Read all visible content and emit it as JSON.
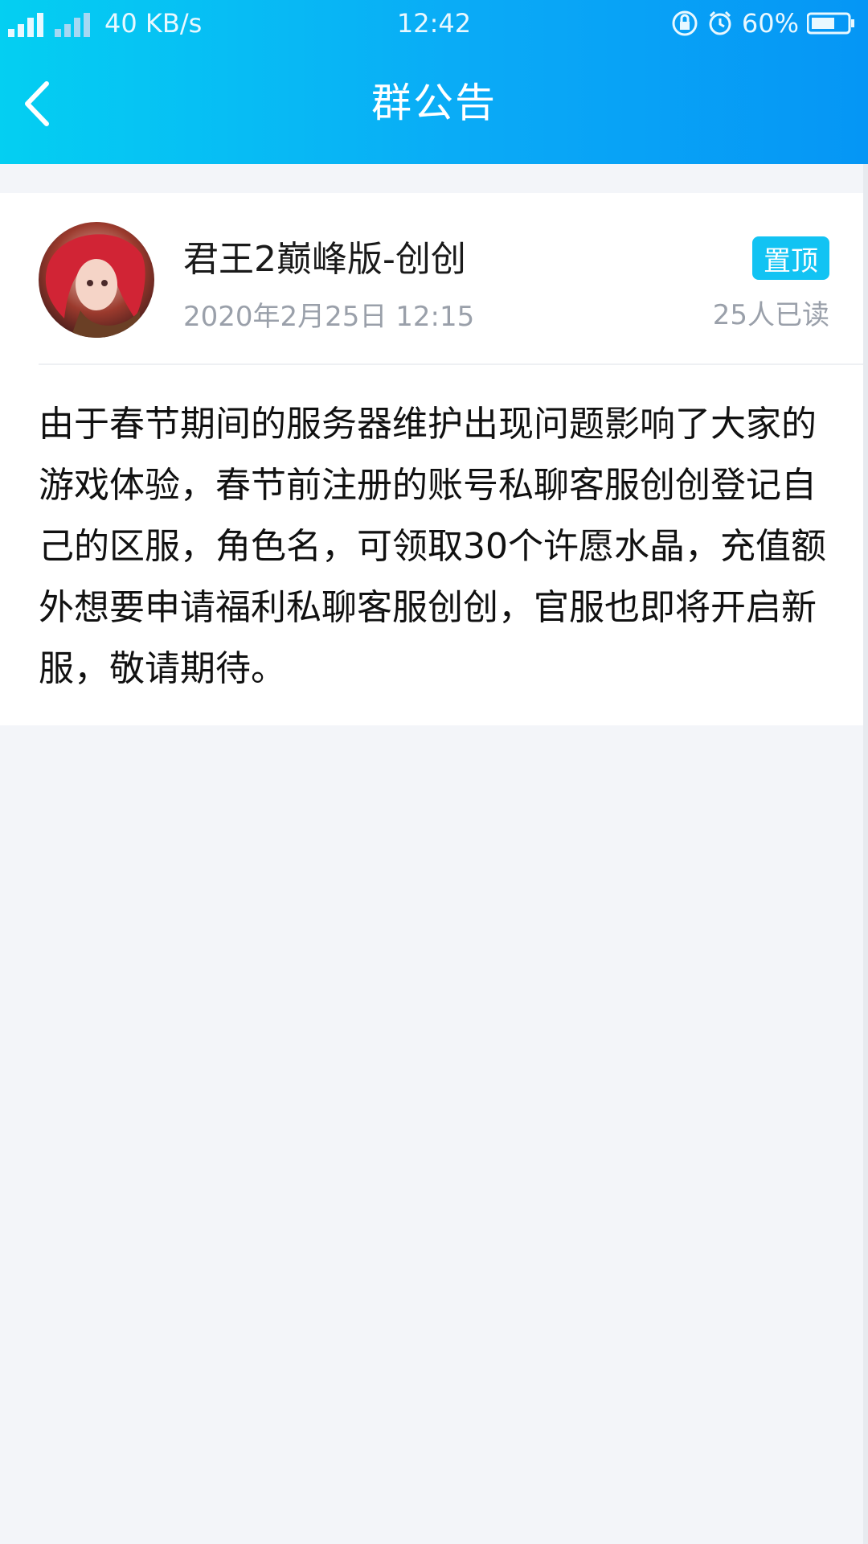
{
  "status_bar": {
    "network": "40 KB/s",
    "time": "12:42",
    "battery": "60%"
  },
  "header": {
    "title": "群公告"
  },
  "announcement": {
    "author": "君王2巅峰版-创创",
    "date": "2020年2月25日 12:15",
    "badge": "置顶",
    "read_count": "25人已读",
    "content": "由于春节期间的服务器维护出现问题影响了大家的游戏体验，春节前注册的账号私聊客服创创登记自己的区服，角色名，可领取30个许愿水晶，充值额外想要申请福利私聊客服创创，官服也即将开启新服，敬请期待。"
  },
  "colors": {
    "header_gradient_start": "#04cff2",
    "header_gradient_end": "#0596f5",
    "badge": "#12c3f3",
    "secondary_text": "#9aa0aa",
    "page_background": "#f3f5f9"
  }
}
